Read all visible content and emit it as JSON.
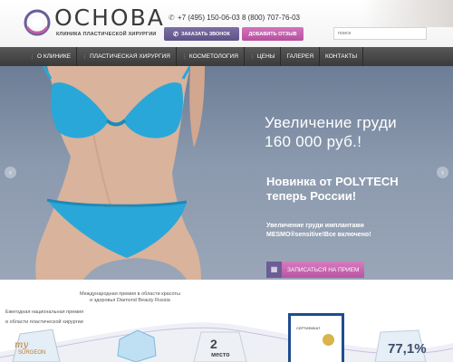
{
  "header": {
    "logo_title": "ОСНОВА",
    "logo_subtitle": "КЛИНИКА ПЛАСТИЧЕСКОЙ ХИРУРГИИ",
    "phones": "+7 (495) 150-06-03  8 (800) 707-76-03",
    "call_button": "Заказать звонок",
    "review_button": "Добавить отзыв",
    "search_placeholder": "поиск"
  },
  "nav": {
    "items": [
      {
        "label": "О КЛИНИКЕ",
        "dropdown": true
      },
      {
        "label": "ПЛАСТИЧЕСКАЯ ХИРУРГИЯ",
        "dropdown": true
      },
      {
        "label": "КОСМЕТОЛОГИЯ",
        "dropdown": true
      },
      {
        "label": "ЦЕНЫ",
        "dropdown": true
      },
      {
        "label": "ГАЛЕРЕЯ",
        "dropdown": false
      },
      {
        "label": "КОНТАКТЫ",
        "dropdown": false
      }
    ]
  },
  "hero": {
    "headline": "Увеличение груди 160 000 руб.!",
    "subheadline": "Новинка от POLYTECH теперь России!",
    "description": "Увеличение груди имплантами MESMO®sensitive!Все включено!",
    "cta": "Записаться на прием"
  },
  "awards": {
    "award_left": "Ежегодная национальная премия в области пластической хирургии",
    "award_left_line1": "Ежегодная национальная премия",
    "award_left_line2": "в области пластической хирургии",
    "award_mid": "Международная премия в области красоты и здоровья Diamond Beauty Russia",
    "mysurgeon": "my",
    "mysurgeon2": "SURGEON",
    "place_number": "2",
    "place_word": "место",
    "certificate": "СЕРТИФИКАТ",
    "percent": "77,1%"
  },
  "colors": {
    "purple": "#6b5d96",
    "pink": "#c060a8",
    "nav_bg": "#4a4a4a",
    "hero_bg": "#7c8ba1",
    "swimsuit": "#2aa7d9"
  }
}
